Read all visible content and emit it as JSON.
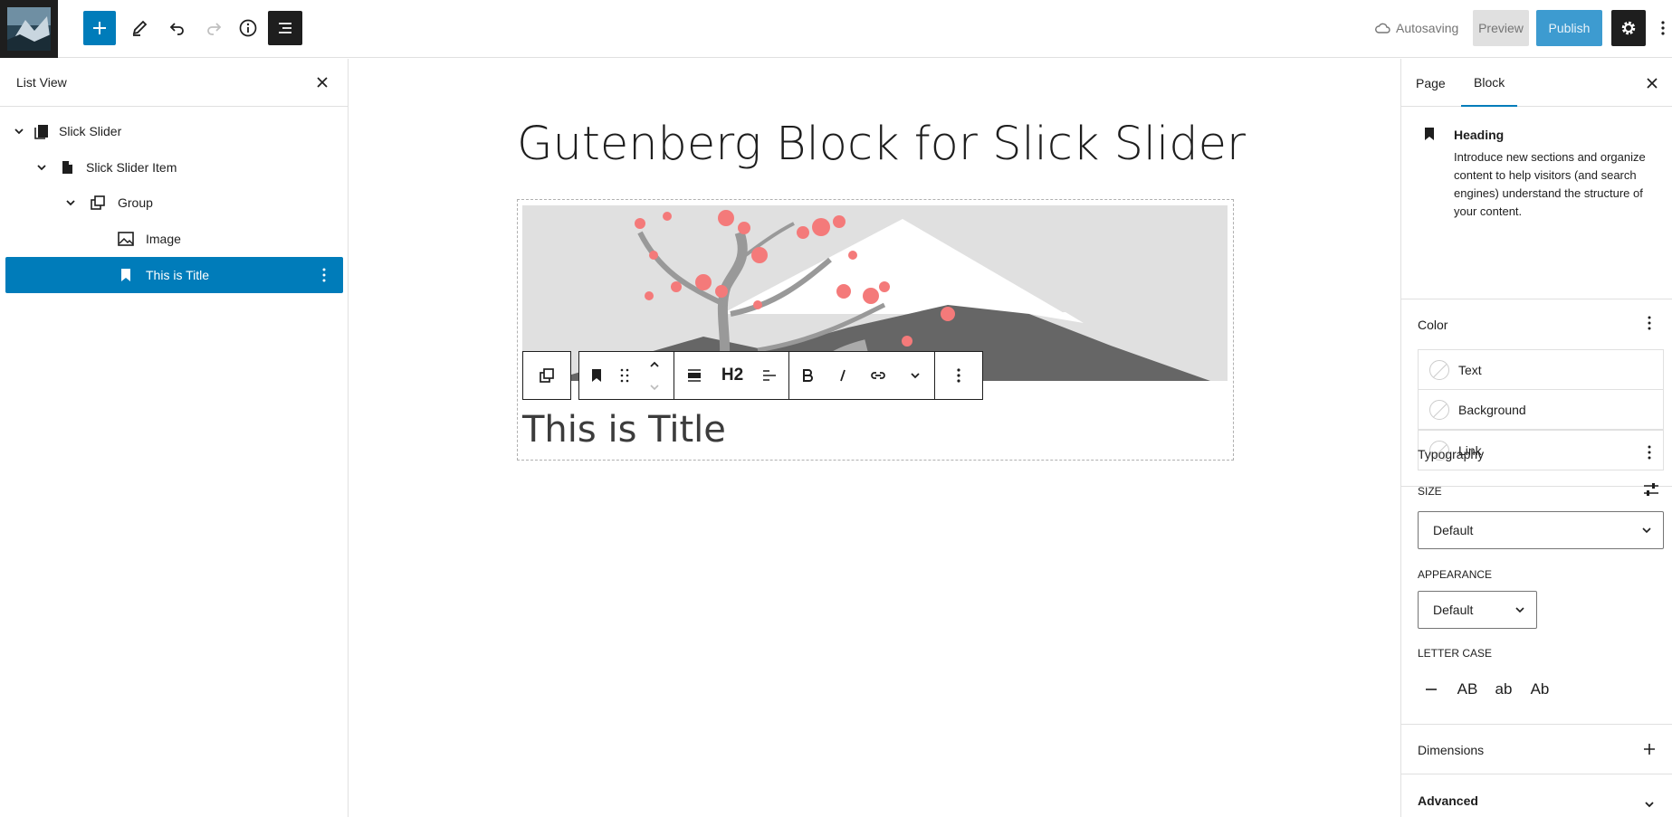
{
  "topbar": {
    "autosave_label": "Autosaving",
    "preview_label": "Preview",
    "publish_label": "Publish"
  },
  "list_view": {
    "title": "List View",
    "items": [
      {
        "label": "Slick Slider"
      },
      {
        "label": "Slick Slider Item"
      },
      {
        "label": "Group"
      },
      {
        "label": "Image"
      },
      {
        "label": "This is Title"
      }
    ]
  },
  "canvas": {
    "post_title": "Gutenberg Block for Slick Slider",
    "block_title": "This is Title",
    "heading_level": "H2"
  },
  "sidebar": {
    "tabs": [
      {
        "label": "Page"
      },
      {
        "label": "Block"
      }
    ],
    "block_card": {
      "title": "Heading",
      "description": "Introduce new sections and organize content to help visitors (and search engines) understand the structure of your content."
    },
    "color": {
      "title": "Color",
      "items": [
        {
          "label": "Text"
        },
        {
          "label": "Background"
        },
        {
          "label": "Link"
        }
      ]
    },
    "typography": {
      "title": "Typography",
      "size_label": "SIZE",
      "size_value": "Default",
      "appearance_label": "APPEARANCE",
      "appearance_value": "Default",
      "letter_case_label": "LETTER CASE",
      "letter_case_options": [
        "AB",
        "ab",
        "Ab"
      ]
    },
    "dimensions_title": "Dimensions",
    "advanced_title": "Advanced"
  },
  "colors": {
    "accent": "#007cba",
    "publish": "#3d9bd0",
    "dark": "#1e1e1e"
  }
}
